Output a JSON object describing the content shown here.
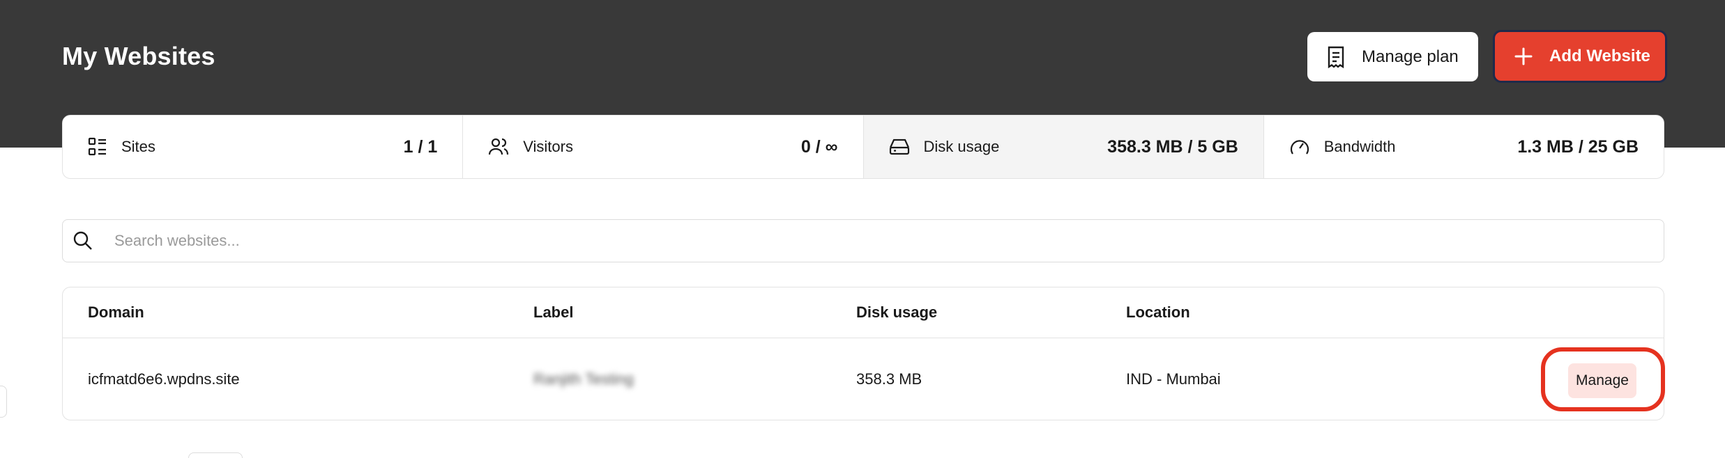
{
  "header": {
    "title": "My Websites",
    "manage_plan_label": "Manage plan",
    "add_website_label": "Add Website"
  },
  "stats": [
    {
      "label": "Sites",
      "value": "1 / 1",
      "icon": "list-icon"
    },
    {
      "label": "Visitors",
      "value": "0 / ∞",
      "icon": "users-icon"
    },
    {
      "label": "Disk usage",
      "value": "358.3 MB / 5 GB",
      "icon": "hard-drive-icon"
    },
    {
      "label": "Bandwidth",
      "value": "1.3 MB / 25 GB",
      "icon": "gauge-icon"
    }
  ],
  "search": {
    "placeholder": "Search websites..."
  },
  "table": {
    "columns": [
      "Domain",
      "Label",
      "Disk usage",
      "Location"
    ],
    "rows": [
      {
        "domain": "icfmatd6e6.wpdns.site",
        "label": "Ranjith Testing",
        "disk_usage": "358.3 MB",
        "location": "IND - Mumbai",
        "action_label": "Manage"
      }
    ]
  },
  "colors": {
    "header_bg": "#393939",
    "accent": "#e5402e",
    "manage_button_bg": "#fde3e0"
  }
}
